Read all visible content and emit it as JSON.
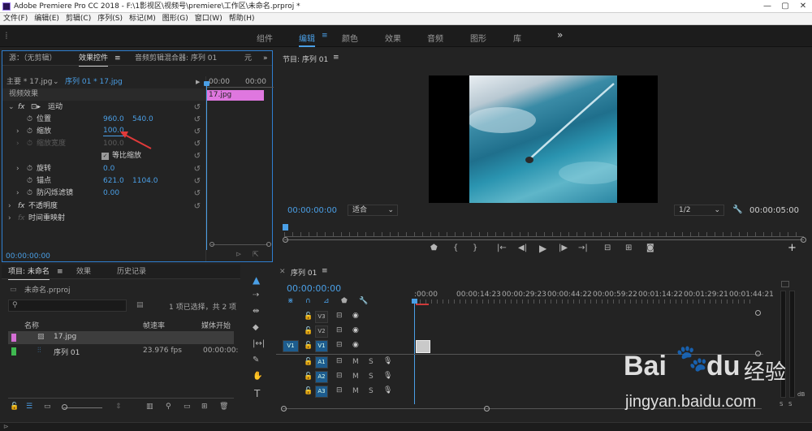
{
  "window": {
    "title": "Adobe Premiere Pro CC 2018 - F:\\1影视区\\视频号\\premiere\\工作区\\未命名.prproj *",
    "min": "—",
    "max": "▢",
    "close": "✕"
  },
  "menu": [
    "文件(F)",
    "编辑(E)",
    "剪辑(C)",
    "序列(S)",
    "标记(M)",
    "图形(G)",
    "窗口(W)",
    "帮助(H)"
  ],
  "workspaces": {
    "tabs": [
      "组件",
      "编辑",
      "颜色",
      "效果",
      "音频",
      "图形",
      "库"
    ],
    "active": "编辑",
    "more": "»"
  },
  "effect_controls": {
    "tabs": [
      "源：（无剪辑）",
      "效果控件",
      "音频剪辑混合器: 序列 01",
      "元"
    ],
    "master": "主要 * 17.jpg",
    "clip": "序列 01 * 17.jpg",
    "time_start": "00:00",
    "time_end": "00:00",
    "clip_bar": "17.jpg",
    "section": "视频效果",
    "motion": "运动",
    "position_label": "位置",
    "position_x": "960.0",
    "position_y": "540.0",
    "scale_label": "缩放",
    "scale_value": "100.0",
    "scale_width_label": "缩放宽度",
    "scale_width_value": "100.0",
    "uniform_label": "等比缩放",
    "rotation_label": "旋转",
    "rotation_value": "0.0",
    "anchor_label": "锚点",
    "anchor_x": "621.0",
    "anchor_y": "1104.0",
    "flicker_label": "防闪烁滤镜",
    "flicker_value": "0.00",
    "opacity": "不透明度",
    "remap": "时间重映射",
    "timecode": "00:00:00:00"
  },
  "program": {
    "title": "节目: 序列 01",
    "timecode": "00:00:00:00",
    "fit": "适合",
    "resolution": "1/2",
    "duration": "00:00:05:00",
    "add": "+"
  },
  "project": {
    "tabs": [
      "项目: 未命名",
      "效果",
      "历史记录"
    ],
    "file": "未命名.prproj",
    "selection": "1 项已选择，共 2 项",
    "columns": [
      "名称",
      "帧速率",
      "媒体开始"
    ],
    "items": [
      {
        "name": "17.jpg",
        "fps": "",
        "start": "",
        "color": "#d46fd4"
      },
      {
        "name": "序列 01",
        "fps": "23.976 fps",
        "start": "00:00:00:",
        "color": "#3fb950"
      }
    ]
  },
  "timeline": {
    "title": "序列 01",
    "timecode": "00:00:00:00",
    "ruler": [
      ":00:00",
      "00:00:14:23",
      "00:00:29:23",
      "00:00:44:22",
      "00:00:59:22",
      "00:01:14:22",
      "00:01:29:21",
      "00:01:44:21"
    ],
    "video_tracks": [
      "V3",
      "V2",
      "V1"
    ],
    "audio_tracks": [
      "A1",
      "A2",
      "A3"
    ],
    "source_v": "V1",
    "m": "M",
    "s": "S"
  },
  "meter": {
    "db": "dB",
    "s": "S",
    "s2": "S"
  },
  "watermark": {
    "brand": "Bai",
    "brand2": "du",
    "cn": "经验",
    "url": "jingyan.baidu.com"
  }
}
